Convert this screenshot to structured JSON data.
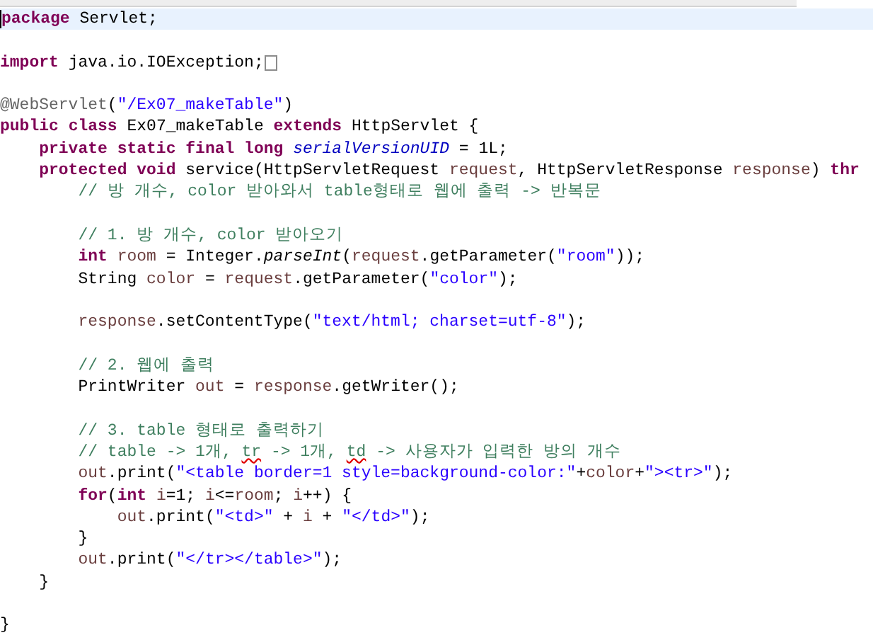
{
  "editor": {
    "lines": [
      {
        "current": true,
        "tokens": [
          {
            "t": "package",
            "kind": "keyword"
          },
          {
            "t": " Servlet;",
            "kind": "plain"
          }
        ]
      },
      {
        "space_before": true,
        "folded": true,
        "tokens": [
          {
            "t": "import",
            "kind": "keyword"
          },
          {
            "t": " java.io.IOException;",
            "kind": "plain"
          }
        ]
      },
      {
        "space_before": true,
        "tokens": [
          {
            "t": "@WebServlet",
            "kind": "annotation"
          },
          {
            "t": "(",
            "kind": "plain"
          },
          {
            "t": "\"/Ex07_makeTable\"",
            "kind": "string"
          },
          {
            "t": ")",
            "kind": "plain"
          }
        ]
      },
      {
        "tokens": [
          {
            "t": "public",
            "kind": "keyword"
          },
          {
            "t": " class",
            "kind": "keyword"
          },
          {
            "t": " Ex07_makeTable",
            "kind": "plain"
          },
          {
            "t": " extends",
            "kind": "keyword"
          },
          {
            "t": " HttpServlet {",
            "kind": "plain"
          }
        ]
      },
      {
        "tokens": [
          {
            "t": "    private",
            "kind": "keyword"
          },
          {
            "t": " static",
            "kind": "keyword"
          },
          {
            "t": " final",
            "kind": "keyword"
          },
          {
            "t": " long",
            "kind": "keyword"
          },
          {
            "t": " serialVersionUID",
            "kind": "static-field"
          },
          {
            "t": " = 1L;",
            "kind": "plain"
          }
        ]
      },
      {
        "tokens": [
          {
            "t": "    protected",
            "kind": "keyword"
          },
          {
            "t": " void",
            "kind": "keyword"
          },
          {
            "t": " service(HttpServletRequest",
            "kind": "plain"
          },
          {
            "t": " request",
            "kind": "variable"
          },
          {
            "t": ", HttpServletResponse",
            "kind": "plain"
          },
          {
            "t": " response",
            "kind": "variable"
          },
          {
            "t": ")",
            "kind": "plain"
          },
          {
            "t": " thr",
            "kind": "keyword"
          }
        ]
      },
      {
        "tokens": [
          {
            "t": "        // 방 개수, color 받아와서 table형태로 웹에 출력 -> 반복문",
            "kind": "comment"
          }
        ]
      },
      {
        "space_before": true,
        "tokens": [
          {
            "t": "        // 1. 방 개수, color 받아오기",
            "kind": "comment"
          }
        ]
      },
      {
        "tokens": [
          {
            "t": "        int",
            "kind": "keyword"
          },
          {
            "t": " room",
            "kind": "variable"
          },
          {
            "t": " = Integer.",
            "kind": "plain"
          },
          {
            "t": "parseInt",
            "kind": "static-method"
          },
          {
            "t": "(",
            "kind": "plain"
          },
          {
            "t": "request",
            "kind": "variable"
          },
          {
            "t": ".getParameter(",
            "kind": "plain"
          },
          {
            "t": "\"room\"",
            "kind": "string"
          },
          {
            "t": "));",
            "kind": "plain"
          }
        ]
      },
      {
        "tokens": [
          {
            "t": "        String",
            "kind": "plain"
          },
          {
            "t": " color",
            "kind": "variable"
          },
          {
            "t": " =",
            "kind": "plain"
          },
          {
            "t": " request",
            "kind": "variable"
          },
          {
            "t": ".getParameter(",
            "kind": "plain"
          },
          {
            "t": "\"color\"",
            "kind": "string"
          },
          {
            "t": ");",
            "kind": "plain"
          }
        ]
      },
      {
        "space_before": true,
        "tokens": [
          {
            "t": "        response",
            "kind": "variable"
          },
          {
            "t": ".setContentType(",
            "kind": "plain"
          },
          {
            "t": "\"text/html; charset=utf-8\"",
            "kind": "string"
          },
          {
            "t": ");",
            "kind": "plain"
          }
        ]
      },
      {
        "space_before": true,
        "tokens": [
          {
            "t": "        // 2. 웹에 출력",
            "kind": "comment"
          }
        ]
      },
      {
        "tokens": [
          {
            "t": "        PrintWriter",
            "kind": "plain"
          },
          {
            "t": " out",
            "kind": "variable"
          },
          {
            "t": " =",
            "kind": "plain"
          },
          {
            "t": " response",
            "kind": "variable"
          },
          {
            "t": ".getWriter();",
            "kind": "plain"
          }
        ]
      },
      {
        "space_before": true,
        "tokens": [
          {
            "t": "        // 3. table 형태로 출력하기",
            "kind": "comment"
          }
        ]
      },
      {
        "tokens": [
          {
            "t": "        // table -> 1개, ",
            "kind": "comment",
            "misspelled": false
          },
          {
            "t": "tr",
            "kind": "comment",
            "misspelled": true
          },
          {
            "t": " -> 1개, ",
            "kind": "comment",
            "misspelled": false
          },
          {
            "t": "td",
            "kind": "comment",
            "misspelled": true
          },
          {
            "t": " -> 사용자가 입력한 방의 개수",
            "kind": "comment",
            "misspelled": false
          }
        ]
      },
      {
        "tokens": [
          {
            "t": "        out",
            "kind": "variable"
          },
          {
            "t": ".print(",
            "kind": "plain"
          },
          {
            "t": "\"<table border=1 style=background-color:\"",
            "kind": "string"
          },
          {
            "t": "+",
            "kind": "plain"
          },
          {
            "t": "color",
            "kind": "variable"
          },
          {
            "t": "+",
            "kind": "plain"
          },
          {
            "t": "\"><tr>\"",
            "kind": "string"
          },
          {
            "t": ");",
            "kind": "plain"
          }
        ]
      },
      {
        "tokens": [
          {
            "t": "        for",
            "kind": "keyword"
          },
          {
            "t": "(",
            "kind": "plain"
          },
          {
            "t": "int",
            "kind": "keyword"
          },
          {
            "t": " i",
            "kind": "variable"
          },
          {
            "t": "=1;",
            "kind": "plain"
          },
          {
            "t": " i",
            "kind": "variable"
          },
          {
            "t": "<=",
            "kind": "plain"
          },
          {
            "t": "room",
            "kind": "variable"
          },
          {
            "t": ";",
            "kind": "plain"
          },
          {
            "t": " i",
            "kind": "variable"
          },
          {
            "t": "++) {",
            "kind": "plain"
          }
        ]
      },
      {
        "tokens": [
          {
            "t": "            out",
            "kind": "variable"
          },
          {
            "t": ".print(",
            "kind": "plain"
          },
          {
            "t": "\"<td>\"",
            "kind": "string"
          },
          {
            "t": " +",
            "kind": "plain"
          },
          {
            "t": " i",
            "kind": "variable"
          },
          {
            "t": " +",
            "kind": "plain"
          },
          {
            "t": " \"</td>\"",
            "kind": "string"
          },
          {
            "t": ");",
            "kind": "plain"
          }
        ]
      },
      {
        "tokens": [
          {
            "t": "        }",
            "kind": "plain"
          }
        ]
      },
      {
        "tokens": [
          {
            "t": "        out",
            "kind": "variable"
          },
          {
            "t": ".print(",
            "kind": "plain"
          },
          {
            "t": "\"</tr></table>\"",
            "kind": "string"
          },
          {
            "t": ");",
            "kind": "plain"
          }
        ]
      },
      {
        "tokens": [
          {
            "t": "    }",
            "kind": "plain"
          }
        ]
      },
      {
        "space_before": true,
        "tokens": [
          {
            "t": "}",
            "kind": "plain"
          }
        ]
      }
    ]
  }
}
